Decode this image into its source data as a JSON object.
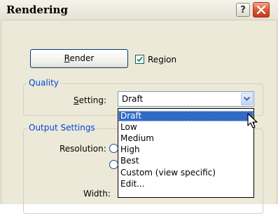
{
  "window": {
    "title": "Rendering",
    "help_glyph": "?",
    "close_icon": "close-icon"
  },
  "render_button": {
    "label_ul": "R",
    "label_rest": "ender"
  },
  "region_checkbox": {
    "checked": true,
    "label_pre": "Re",
    "label_ul": "g",
    "label_post": "ion"
  },
  "quality": {
    "group_title": "Quality",
    "setting_label_ul": "S",
    "setting_label_rest": "etting:",
    "selected_value": "Draft",
    "options": [
      "Draft",
      "Low",
      "Medium",
      "High",
      "Best",
      "Custom (view specific)",
      "Edit..."
    ],
    "highlighted_index": 0
  },
  "output_settings": {
    "group_title": "Output Settings",
    "resolution_label": "Resolution:",
    "width_label": "Width:"
  },
  "colors": {
    "group_title": "#0046d5",
    "dialog_bg": "#ece9d8",
    "selection": "#316ac5",
    "close_button": "#d9532e"
  }
}
